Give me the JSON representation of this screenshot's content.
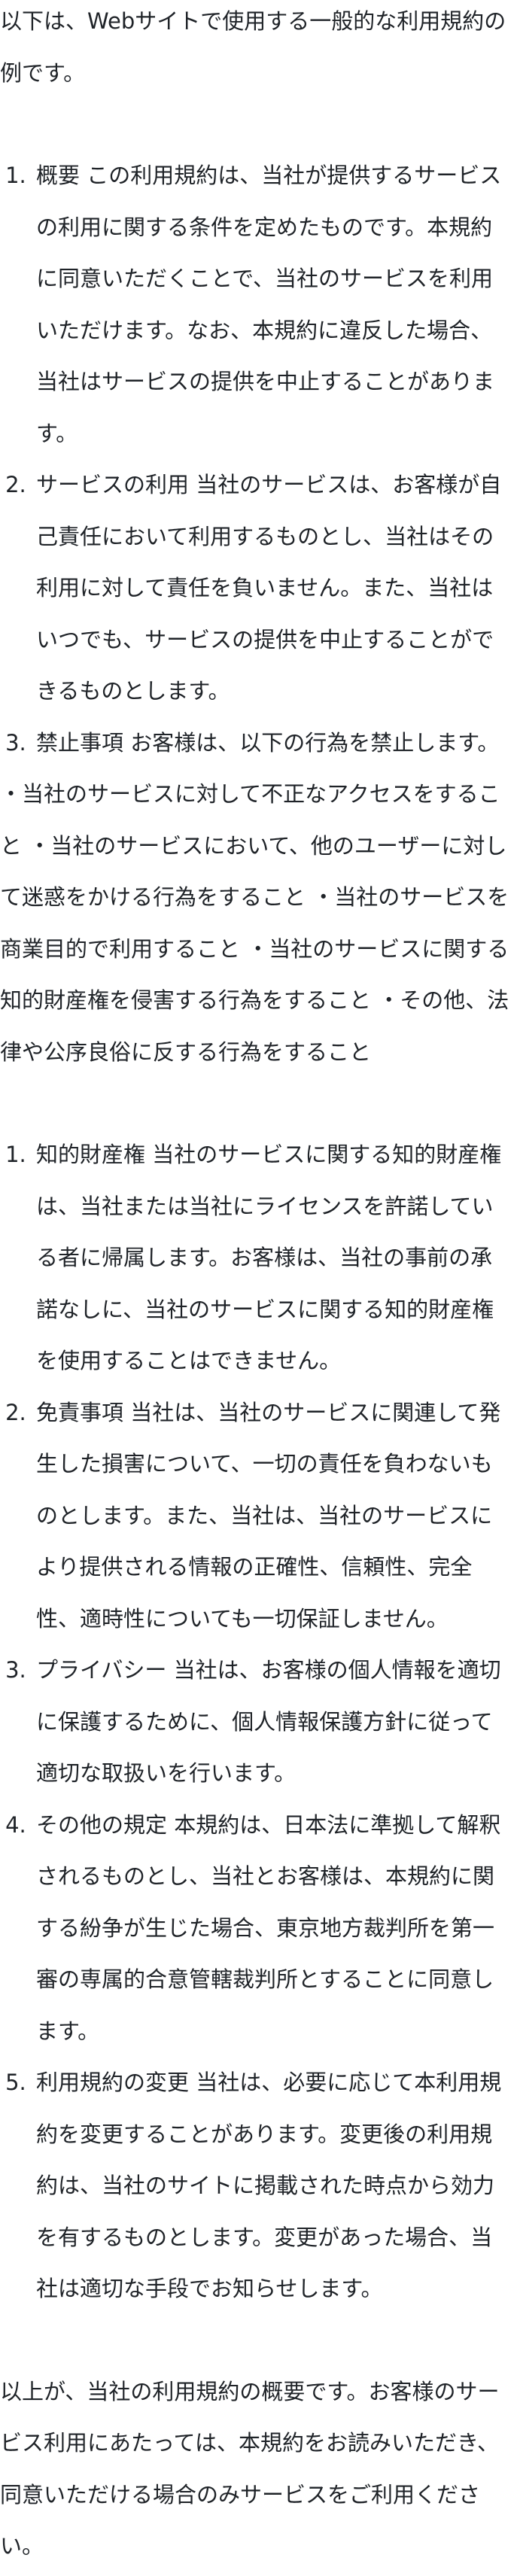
{
  "intro": "以下は、Webサイトで使用する一般的な利用規約の例です。",
  "list_a": [
    "概要 この利用規約は、当社が提供するサービスの利用に関する条件を定めたものです。本規約に同意いただくことで、当社のサービスを利用いただけます。なお、本規約に違反した場合、当社はサービスの提供を中止することがあります。",
    "サービスの利用 当社のサービスは、お客様が自己責任において利用するものとし、当社はその利用に対して責任を負いません。また、当社はいつでも、サービスの提供を中止することができるものとします。",
    "禁止事項 お客様は、以下の行為を禁止します。"
  ],
  "prohibited": "・当社のサービスに対して不正なアクセスをすること ・当社のサービスにおいて、他のユーザーに対して迷惑をかける行為をすること ・当社のサービスを商業目的で利用すること ・当社のサービスに関する知的財産権を侵害する行為をすること ・その他、法律や公序良俗に反する行為をすること",
  "list_b": [
    "知的財産権 当社のサービスに関する知的財産権は、当社または当社にライセンスを許諾している者に帰属します。お客様は、当社の事前の承諾なしに、当社のサービスに関する知的財産権を使用することはできません。",
    "免責事項 当社は、当社のサービスに関連して発生した損害について、一切の責任を負わないものとします。また、当社は、当社のサービスにより提供される情報の正確性、信頼性、完全性、適時性についても一切保証しません。",
    "プライバシー 当社は、お客様の個人情報を適切に保護するために、個人情報保護方針に従って適切な取扱いを行います。",
    "その他の規定 本規約は、日本法に準拠して解釈されるものとし、当社とお客様は、本規約に関する紛争が生じた場合、東京地方裁判所を第一審の専属的合意管轄裁判所とすることに同意します。",
    "利用規約の変更 当社は、必要に応じて本利用規約を変更することがあります。変更後の利用規約は、当社のサイトに掲載された時点から効力を有するものとします。変更があった場合、当社は適切な手段でお知らせします。"
  ],
  "outro": "以上が、当社の利用規約の概要です。お客様のサービス利用にあたっては、本規約をお読みいただき、同意いただける場合のみサービスをご利用ください。"
}
